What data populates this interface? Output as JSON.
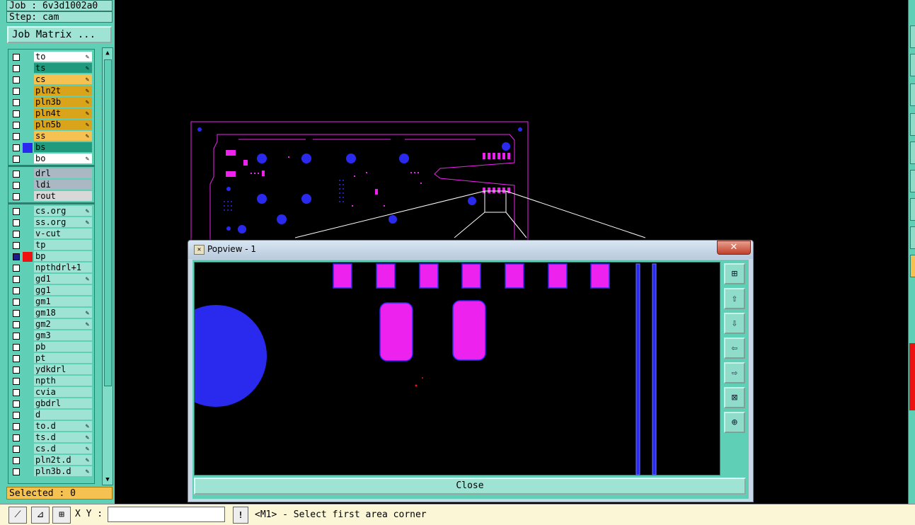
{
  "header": {
    "job": "Job : 6v3d1002a0",
    "step": "Step: cam"
  },
  "job_matrix_label": "Job Matrix ...",
  "layers": [
    {
      "name": "to",
      "bg": "#ffffff",
      "edit": true,
      "checked": false,
      "mark": ""
    },
    {
      "name": "ts",
      "bg": "#1f9a7c",
      "edit": true,
      "checked": false,
      "mark": ""
    },
    {
      "name": "cs",
      "bg": "#f5c251",
      "edit": true,
      "checked": false,
      "mark": ""
    },
    {
      "name": "pln2t",
      "bg": "#d9a41a",
      "edit": true,
      "checked": false,
      "mark": ""
    },
    {
      "name": "pln3b",
      "bg": "#d9a41a",
      "edit": true,
      "checked": false,
      "mark": ""
    },
    {
      "name": "pln4t",
      "bg": "#d9a41a",
      "edit": true,
      "checked": false,
      "mark": ""
    },
    {
      "name": "pln5b",
      "bg": "#d9a41a",
      "edit": true,
      "checked": false,
      "mark": ""
    },
    {
      "name": "ss",
      "bg": "#f5c251",
      "edit": true,
      "checked": false,
      "mark": ""
    },
    {
      "name": "bs",
      "bg": "#1f9a7c",
      "edit": false,
      "checked": false,
      "mark": "#2a2aee"
    },
    {
      "name": "bo",
      "bg": "#ffffff",
      "edit": true,
      "checked": false,
      "mark": ""
    },
    {
      "name": "drl",
      "bg": "#a9b8c2",
      "edit": false,
      "checked": false,
      "mark": ""
    },
    {
      "name": "ldi",
      "bg": "#a9b8c2",
      "edit": false,
      "checked": false,
      "mark": ""
    },
    {
      "name": "rout",
      "bg": "#d8d8d8",
      "edit": false,
      "checked": false,
      "mark": ""
    },
    {
      "name": "cs.org",
      "bg": "#9fe3d5",
      "edit": true,
      "checked": false,
      "mark": ""
    },
    {
      "name": "ss.org",
      "bg": "#9fe3d5",
      "edit": true,
      "checked": false,
      "mark": ""
    },
    {
      "name": "v-cut",
      "bg": "#9fe3d5",
      "edit": false,
      "checked": false,
      "mark": ""
    },
    {
      "name": "tp",
      "bg": "#9fe3d5",
      "edit": false,
      "checked": false,
      "mark": ""
    },
    {
      "name": "bp",
      "bg": "#9fe3d5",
      "edit": false,
      "checked": true,
      "mark": "#ee1111"
    },
    {
      "name": "npthdrl+1",
      "bg": "#9fe3d5",
      "edit": false,
      "checked": false,
      "mark": ""
    },
    {
      "name": "gd1",
      "bg": "#9fe3d5",
      "edit": true,
      "checked": false,
      "mark": ""
    },
    {
      "name": "gg1",
      "bg": "#9fe3d5",
      "edit": false,
      "checked": false,
      "mark": ""
    },
    {
      "name": "gm1",
      "bg": "#9fe3d5",
      "edit": false,
      "checked": false,
      "mark": ""
    },
    {
      "name": "gm18",
      "bg": "#9fe3d5",
      "edit": true,
      "checked": false,
      "mark": ""
    },
    {
      "name": "gm2",
      "bg": "#9fe3d5",
      "edit": true,
      "checked": false,
      "mark": ""
    },
    {
      "name": "gm3",
      "bg": "#9fe3d5",
      "edit": false,
      "checked": false,
      "mark": ""
    },
    {
      "name": "pb",
      "bg": "#9fe3d5",
      "edit": false,
      "checked": false,
      "mark": ""
    },
    {
      "name": "pt",
      "bg": "#9fe3d5",
      "edit": false,
      "checked": false,
      "mark": ""
    },
    {
      "name": "ydkdrl",
      "bg": "#9fe3d5",
      "edit": false,
      "checked": false,
      "mark": ""
    },
    {
      "name": "npth",
      "bg": "#9fe3d5",
      "edit": false,
      "checked": false,
      "mark": ""
    },
    {
      "name": "cvia",
      "bg": "#9fe3d5",
      "edit": false,
      "checked": false,
      "mark": ""
    },
    {
      "name": "gbdrl",
      "bg": "#9fe3d5",
      "edit": false,
      "checked": false,
      "mark": ""
    },
    {
      "name": "d",
      "bg": "#9fe3d5",
      "edit": false,
      "checked": false,
      "mark": ""
    },
    {
      "name": "to.d",
      "bg": "#9fe3d5",
      "edit": true,
      "checked": false,
      "mark": ""
    },
    {
      "name": "ts.d",
      "bg": "#9fe3d5",
      "edit": true,
      "checked": false,
      "mark": ""
    },
    {
      "name": "cs.d",
      "bg": "#9fe3d5",
      "edit": true,
      "checked": false,
      "mark": ""
    },
    {
      "name": "pln2t.d",
      "bg": "#9fe3d5",
      "edit": true,
      "checked": false,
      "mark": ""
    },
    {
      "name": "pln3b.d",
      "bg": "#9fe3d5",
      "edit": true,
      "checked": false,
      "mark": ""
    }
  ],
  "selected_label": "Selected : 0",
  "bottom": {
    "xy_label": "X Y :",
    "xy_value": "",
    "status": "<M1> - Select first area corner",
    "bang": "!"
  },
  "popview": {
    "title": "Popview - 1",
    "close_label": "Close",
    "close_x": "✕"
  },
  "colors": {
    "panel": "#5fcfb5",
    "pad": "#ee22ee",
    "via": "#2a2aee"
  }
}
